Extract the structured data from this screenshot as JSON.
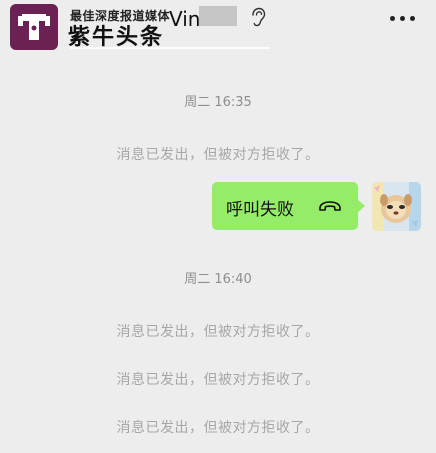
{
  "header": {
    "logo_slogan": "最佳深度报道媒体",
    "logo_brand": "紫牛头条",
    "chat_name": "Vin",
    "ear_icon": "ear-icon",
    "more_icon": "more-dots-icon"
  },
  "messages": [
    {
      "type": "timestamp",
      "text": "周二 16:35"
    },
    {
      "type": "system",
      "text": "消息已发出，但被对方拒收了。"
    },
    {
      "type": "outgoing-call",
      "text": "呼叫失败",
      "icon": "phone-hangup-icon"
    },
    {
      "type": "timestamp",
      "text": "周二 16:40"
    },
    {
      "type": "system",
      "text": "消息已发出，但被对方拒收了。"
    },
    {
      "type": "system",
      "text": "消息已发出，但被对方拒收了。"
    },
    {
      "type": "system",
      "text": "消息已发出，但被对方拒收了。"
    }
  ],
  "colors": {
    "background": "#ededed",
    "bubble": "#95ec69",
    "logo_bg": "#6b2154"
  }
}
